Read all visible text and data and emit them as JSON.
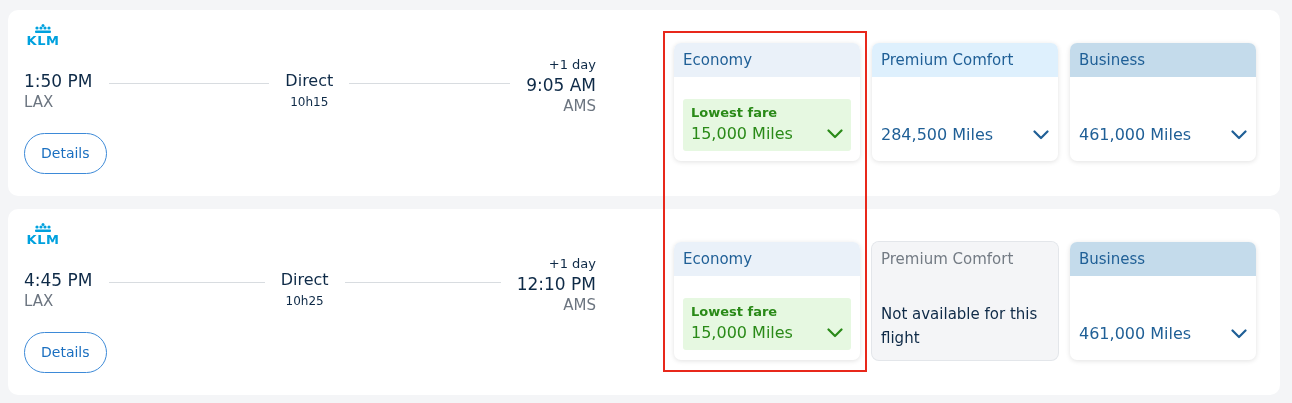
{
  "flights": [
    {
      "airline": "KLM",
      "depart_time": "1:50 PM",
      "depart_airport": "LAX",
      "stops": "Direct",
      "duration": "10h15",
      "day_offset": "+1 day",
      "arrive_time": "9:05 AM",
      "arrive_airport": "AMS",
      "details_button": "Details",
      "fares": [
        {
          "cabin": "Economy",
          "kind": "lowest",
          "color": "#eaf1f9",
          "badge": "Lowest fare",
          "price": "15,000 Miles"
        },
        {
          "cabin": "Premium Comfort",
          "kind": "price",
          "color": "#def0fd",
          "price": "284,500 Miles"
        },
        {
          "cabin": "Business",
          "kind": "price",
          "color": "#c4dbeb",
          "price": "461,000 Miles"
        }
      ]
    },
    {
      "airline": "KLM",
      "depart_time": "4:45 PM",
      "depart_airport": "LAX",
      "stops": "Direct",
      "duration": "10h25",
      "day_offset": "+1 day",
      "arrive_time": "12:10 PM",
      "arrive_airport": "AMS",
      "details_button": "Details",
      "fares": [
        {
          "cabin": "Economy",
          "kind": "lowest",
          "color": "#eaf1f9",
          "badge": "Lowest fare",
          "price": "15,000 Miles"
        },
        {
          "cabin": "Premium Comfort",
          "kind": "unavailable",
          "color": "#f4f5f7",
          "message": "Not available for this flight"
        },
        {
          "cabin": "Business",
          "kind": "price",
          "color": "#c4dbeb",
          "price": "461,000 Miles"
        }
      ]
    }
  ],
  "annotation": {
    "kind": "frame",
    "color": "#e8281b"
  }
}
